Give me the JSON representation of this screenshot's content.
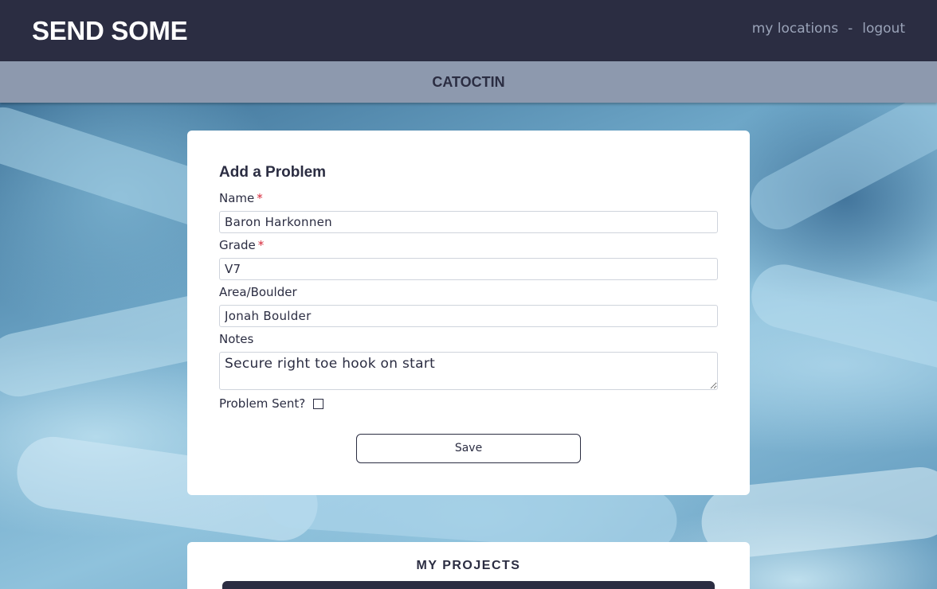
{
  "header": {
    "brand": "SEND SOME",
    "nav": {
      "my_locations": "my locations",
      "separator": "-",
      "logout": "logout"
    }
  },
  "location": {
    "title": "CATOCTIN"
  },
  "form": {
    "title": "Add a Problem",
    "fields": {
      "name": {
        "label": "Name",
        "required_mark": "*",
        "value": "Baron Harkonnen"
      },
      "grade": {
        "label": "Grade",
        "required_mark": "*",
        "value": "V7"
      },
      "area": {
        "label": "Area/Boulder",
        "value": "Jonah Boulder"
      },
      "notes": {
        "label": "Notes",
        "value": "Secure right toe hook on start"
      }
    },
    "sent": {
      "label": "Problem Sent?",
      "checked": false
    },
    "save_label": "Save"
  },
  "projects": {
    "title": "MY PROJECTS"
  },
  "colors": {
    "header_bg": "#2b2d42",
    "subbar_bg": "#8d99ae",
    "required": "#d62839"
  }
}
